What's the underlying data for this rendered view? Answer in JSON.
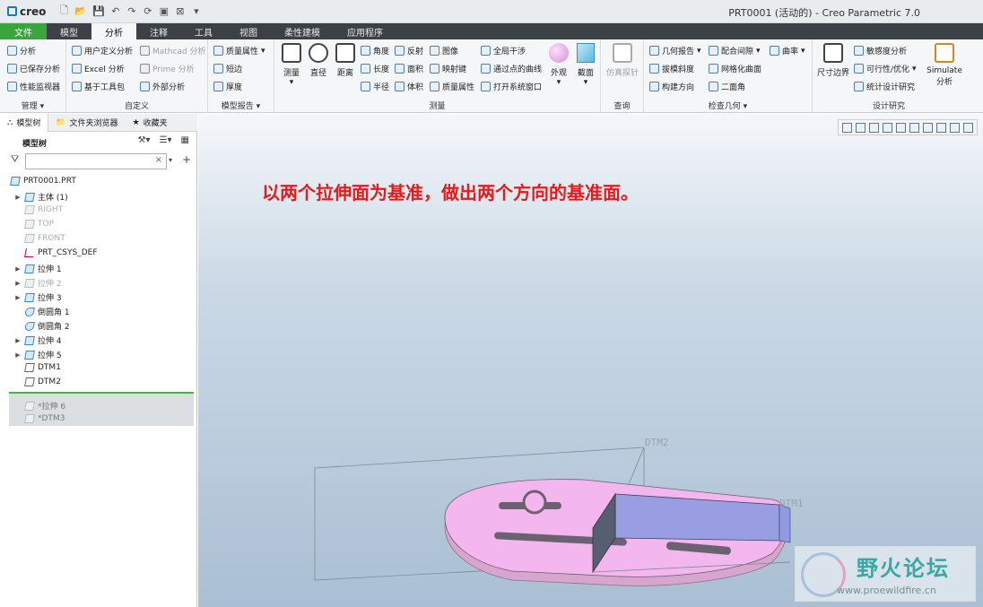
{
  "titlebar": {
    "logo": "creo",
    "window_title": "PRT0001 (活动的) - Creo Parametric 7.0"
  },
  "tabs": [
    "文件",
    "模型",
    "分析",
    "注释",
    "工具",
    "视图",
    "柔性建模",
    "应用程序"
  ],
  "active_tab": "分析",
  "ribbon": {
    "manage": {
      "label": "管理",
      "items": [
        "分析",
        "已保存分析",
        "性能监视器"
      ]
    },
    "custom": {
      "label": "自定义",
      "items": [
        "用户定义分析",
        "Excel 分析",
        "基于工具包",
        "Mathcad 分析",
        "Prime 分析",
        "外部分析"
      ]
    },
    "model_report": {
      "label": "模型报告",
      "items": [
        "质量属性",
        "短边",
        "厚度"
      ]
    },
    "measure": {
      "label": "测量",
      "big": [
        "测量",
        "直径",
        "距离"
      ],
      "items": [
        "角度",
        "长度",
        "半径",
        "反射",
        "面积",
        "体积",
        "图像",
        "映射键",
        "质量属性",
        "全局干涉",
        "通过点的曲线",
        "打开系统窗口"
      ],
      "big_right": [
        "外观",
        "截面"
      ]
    },
    "inspect": {
      "label": "查询",
      "items": [
        "仿真探针"
      ]
    },
    "inspect_geometry": {
      "label": "检查几何",
      "items": [
        "几何报告",
        "拔模斜度",
        "构建方向",
        "配合间隙",
        "网格化曲面",
        "二面角",
        "曲率"
      ]
    },
    "design_study": {
      "label": "设计研究",
      "items": [
        "尺寸边界",
        "敏感度分析",
        "可行性/优化",
        "统计设计研究",
        "Simulate 分析"
      ]
    }
  },
  "left_panel": {
    "tabs": [
      "模型树",
      "文件夹浏览器",
      "收藏夹"
    ],
    "header": "模型树",
    "tree": [
      {
        "label": "PRT0001.PRT",
        "state": "normal"
      },
      {
        "label": "主体 (1)",
        "state": "normal"
      },
      {
        "label": "RIGHT",
        "state": "dim"
      },
      {
        "label": "TOP",
        "state": "dim"
      },
      {
        "label": "FRONT",
        "state": "dim"
      },
      {
        "label": "PRT_CSYS_DEF",
        "state": "normal"
      },
      {
        "label": "拉伸 1",
        "state": "normal"
      },
      {
        "label": "拉伸 2",
        "state": "dim"
      },
      {
        "label": "拉伸 3",
        "state": "normal"
      },
      {
        "label": "倒圆角 1",
        "state": "normal"
      },
      {
        "label": "倒圆角 2",
        "state": "normal"
      },
      {
        "label": "拉伸 4",
        "state": "normal"
      },
      {
        "label": "拉伸 5",
        "state": "normal"
      },
      {
        "label": "DTM1",
        "state": "normal"
      },
      {
        "label": "DTM2",
        "state": "normal"
      }
    ],
    "suppressed": [
      "*拉伸 6",
      "*DTM3"
    ]
  },
  "viewport": {
    "annotation": "以两个拉伸面为基准，做出两个方向的基准面。",
    "dtm_labels": [
      "DTM2",
      "DTM1"
    ]
  },
  "watermark": {
    "title": "野火论坛",
    "url": "www.proewildfire.cn"
  },
  "colors": {
    "file_tab": "#3aa53c",
    "annotation": "#e51b1b",
    "part_face": "#f4b6ee",
    "selected_face": "#8f9ae0"
  }
}
